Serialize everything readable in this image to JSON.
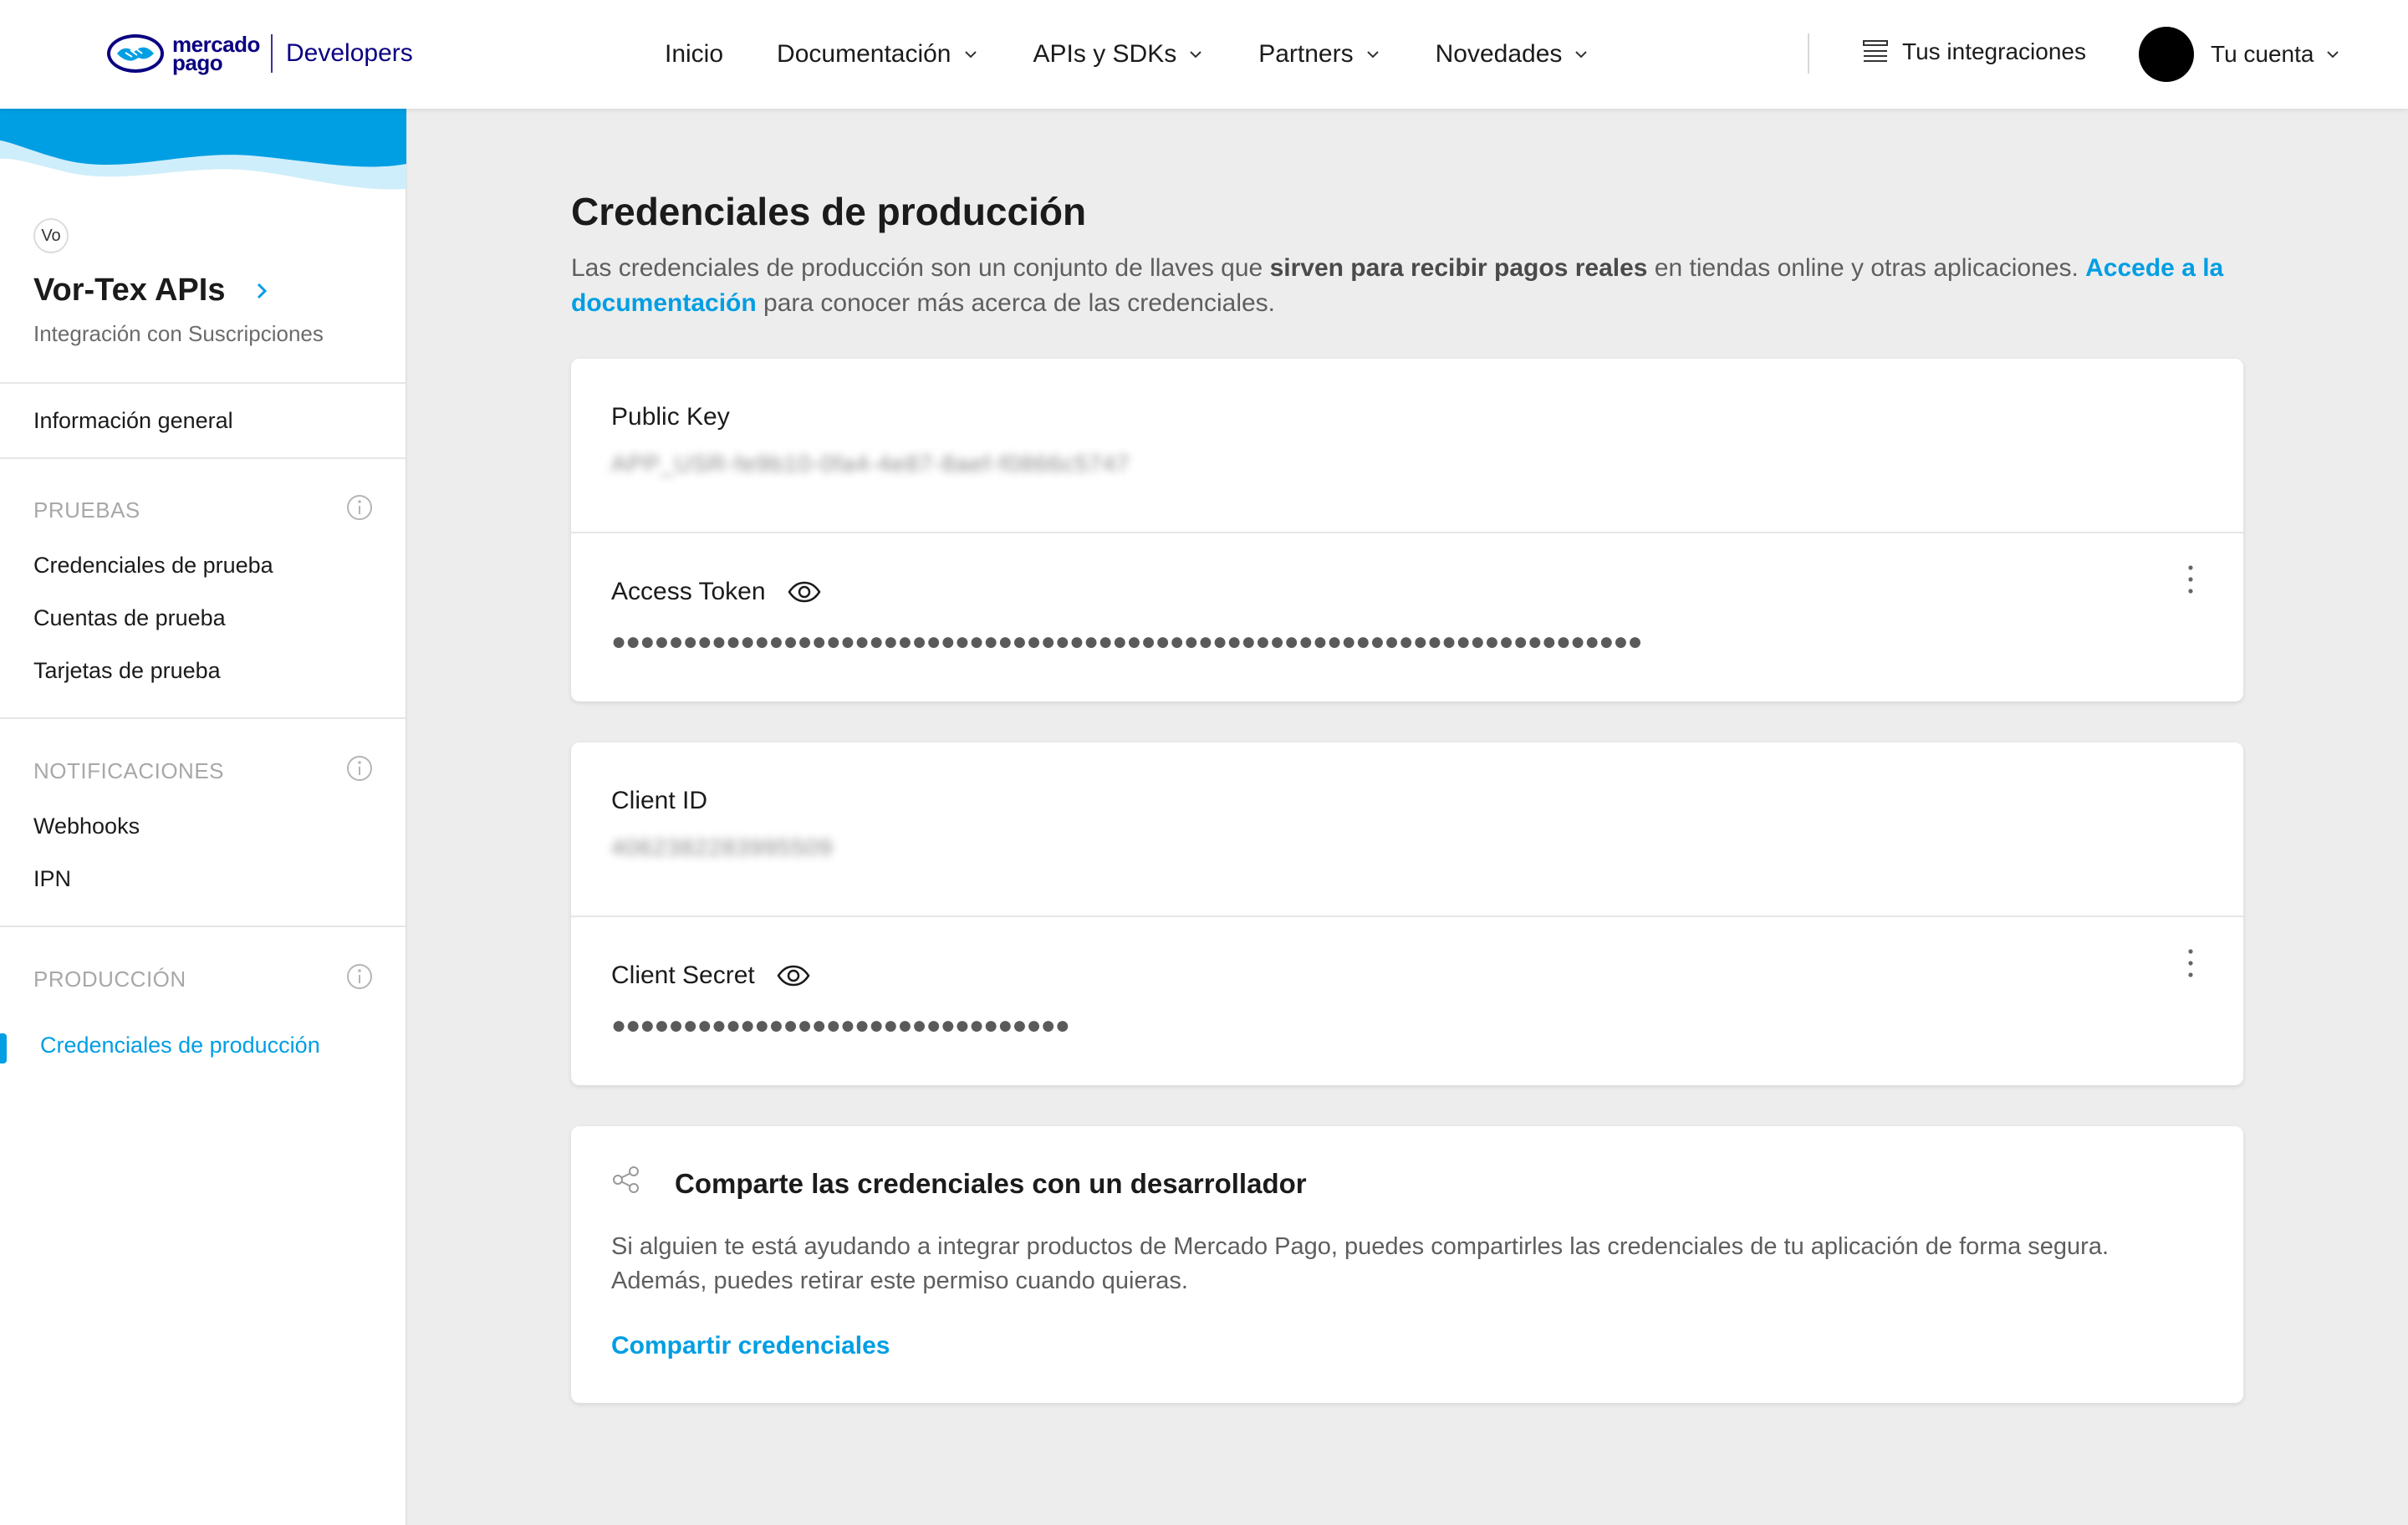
{
  "header": {
    "logo_line1": "mercado",
    "logo_line2": "pago",
    "logo_product": "Developers",
    "nav": [
      {
        "label": "Inicio"
      },
      {
        "label": "Documentación"
      },
      {
        "label": "APIs y SDKs"
      },
      {
        "label": "Partners"
      },
      {
        "label": "Novedades"
      }
    ],
    "integrations_label": "Tus integraciones",
    "account_label": "Tu cuenta"
  },
  "sidebar": {
    "app_initials": "Vo",
    "app_name": "Vor-Tex APIs",
    "app_subtitle": "Integración con Suscripciones",
    "general_info": "Información general",
    "sections": [
      {
        "title": "PRUEBAS",
        "items": [
          "Credenciales de prueba",
          "Cuentas de prueba",
          "Tarjetas de prueba"
        ]
      },
      {
        "title": "NOTIFICACIONES",
        "items": [
          "Webhooks",
          "IPN"
        ]
      },
      {
        "title": "PRODUCCIÓN",
        "items": [
          "Credenciales de producción"
        ]
      }
    ]
  },
  "main": {
    "title": "Credenciales de producción",
    "desc_part1": "Las credenciales de producción son un conjunto de llaves que ",
    "desc_bold": "sirven para recibir pagos reales",
    "desc_part2": " en tiendas online y otras aplicaciones. ",
    "desc_link": "Accede a la documentación",
    "desc_part3": " para conocer más acerca de las credenciales.",
    "public_key_label": "Public Key",
    "public_key_value": "APP_USR-fe9b10-0fa4-4e87-8aef-f0866c5747",
    "access_token_label": "Access Token",
    "access_token_value": "●●●●●●●●●●●●●●●●●●●●●●●●●●●●●●●●●●●●●●●●●●●●●●●●●●●●●●●●●●●●●●●●●●●●●●●●",
    "client_id_label": "Client ID",
    "client_id_value": "4062382283995509",
    "client_secret_label": "Client Secret",
    "client_secret_value": "●●●●●●●●●●●●●●●●●●●●●●●●●●●●●●●●",
    "share_title": "Comparte las credenciales con un desarrollador",
    "share_desc": "Si alguien te está ayudando a integrar productos de Mercado Pago, puedes compartirles las credenciales de tu aplicación de forma segura. Además, puedes retirar este permiso cuando quieras.",
    "share_link": "Compartir credenciales"
  },
  "colors": {
    "accent": "#009ee3",
    "brand": "#0a0080",
    "background": "#ededed"
  }
}
